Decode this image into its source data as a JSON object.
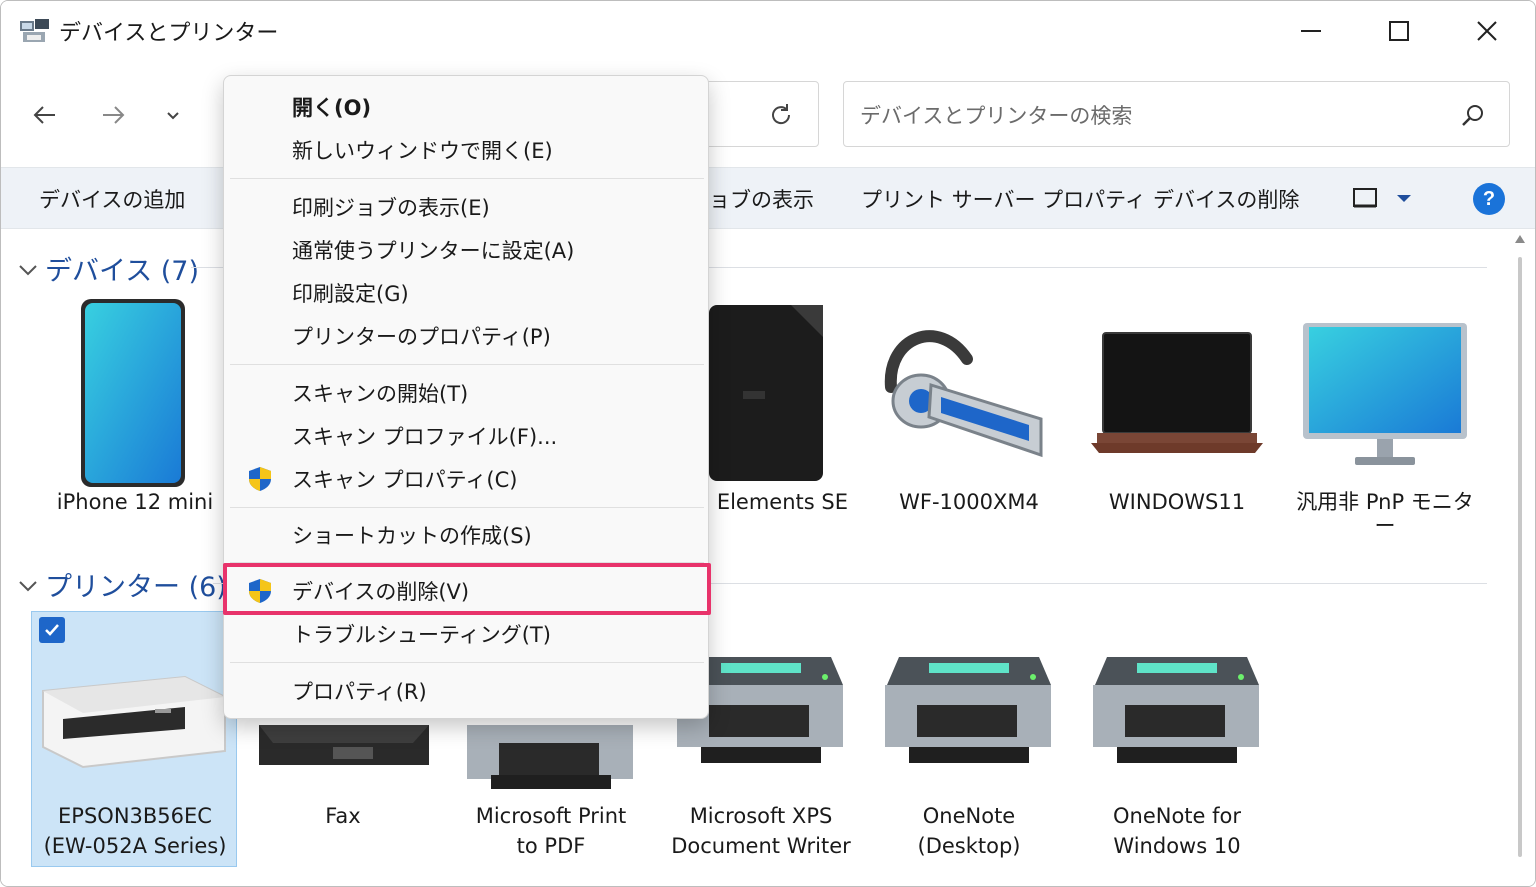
{
  "window": {
    "title": "デバイスとプリンター"
  },
  "search": {
    "placeholder": "デバイスとプリンターの検索"
  },
  "commandbar": {
    "add_device": "デバイスの追加",
    "print_jobs_partial": "ョブの表示",
    "print_server": "プリント サーバー プロパティ",
    "remove_device": "デバイスの削除",
    "help": "?"
  },
  "sections": {
    "devices": {
      "title": "デバイス (7)"
    },
    "printers": {
      "title": "プリンター (6)"
    }
  },
  "devices": [
    {
      "label": "iPhone 12 mini",
      "icon": "phone-icon"
    },
    {
      "label": "D Elements SE",
      "icon": "hard-drive-icon"
    },
    {
      "label": "WF-1000XM4",
      "icon": "headset-icon"
    },
    {
      "label": "WINDOWS11",
      "icon": "laptop-icon"
    },
    {
      "label": "汎用非 PnP モニタ",
      "label2": "ー",
      "icon": "monitor-icon"
    }
  ],
  "printers": [
    {
      "label": "EPSON3B56EC",
      "label2": "(EW-052A Series)",
      "icon": "inkjet-printer-icon",
      "selected": true
    },
    {
      "label": "Fax",
      "label2": "",
      "icon": "fax-icon"
    },
    {
      "label": "Microsoft Print",
      "label2": "to PDF",
      "icon": "printer-icon"
    },
    {
      "label": "Microsoft XPS",
      "label2": "Document Writer",
      "icon": "printer-icon"
    },
    {
      "label": "OneNote",
      "label2": "(Desktop)",
      "icon": "printer-icon"
    },
    {
      "label": "OneNote for",
      "label2": "Windows 10",
      "icon": "printer-icon"
    }
  ],
  "context_menu": {
    "open": "開く(O)",
    "open_new_window": "新しいウィンドウで開く(E)",
    "print_jobs": "印刷ジョブの表示(E)",
    "set_default": "通常使うプリンターに設定(A)",
    "print_settings": "印刷設定(G)",
    "printer_props": "プリンターのプロパティ(P)",
    "start_scan": "スキャンの開始(T)",
    "scan_profiles": "スキャン プロファイル(F)...",
    "scan_props": "スキャン プロパティ(C)",
    "create_shortcut": "ショートカットの作成(S)",
    "remove_device": "デバイスの削除(V)",
    "troubleshoot": "トラブルシューティング(T)",
    "properties": "プロパティ(R)"
  },
  "colors": {
    "accent": "#1f4e9c",
    "highlight_border": "#e8336b",
    "selection": "#cce4f7"
  }
}
